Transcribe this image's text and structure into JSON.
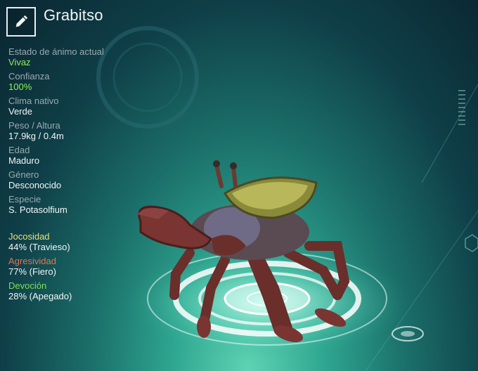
{
  "creature": {
    "name": "Grabitso"
  },
  "stats": [
    {
      "label": "Estado de ánimo actual",
      "value": "Vivaz",
      "highlight": true
    },
    {
      "label": "Confianza",
      "value": "100%",
      "highlight": true
    },
    {
      "label": "Clima nativo",
      "value": "Verde",
      "highlight": false
    },
    {
      "label": "Peso / Altura",
      "value": "17.9kg / 0.4m",
      "highlight": false
    },
    {
      "label": "Edad",
      "value": "Maduro",
      "highlight": false
    },
    {
      "label": "Género",
      "value": "Desconocido",
      "highlight": false
    },
    {
      "label": "Especie",
      "value": "S. Potasolfium",
      "highlight": false
    }
  ],
  "traits": [
    {
      "label": "Jocosidad",
      "value": "44% (Travieso)",
      "color": "#e6e07a"
    },
    {
      "label": "Agresividad",
      "value": "77% (Fiero)",
      "color": "#e8734f"
    },
    {
      "label": "Devoción",
      "value": "28% (Apegado)",
      "color": "#7de05a"
    }
  ],
  "colors": {
    "highlight_green": "#8df05a",
    "label_gray": "#9aaab0"
  },
  "icons": {
    "edit": "pencil-icon"
  }
}
